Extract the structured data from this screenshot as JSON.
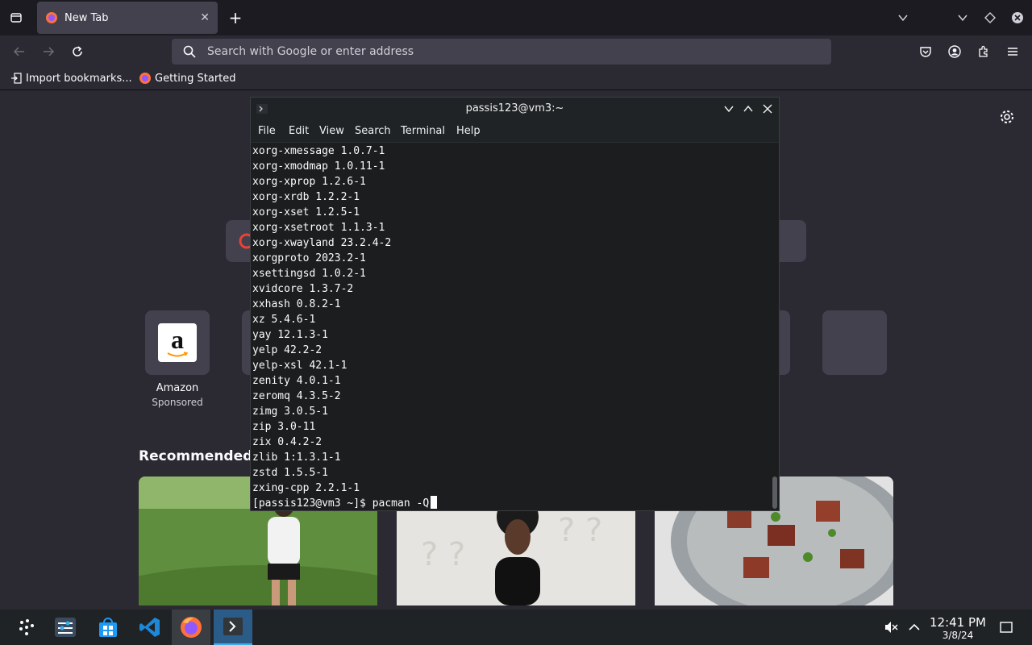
{
  "browser": {
    "tab": {
      "title": "New Tab"
    },
    "urlbar": {
      "placeholder": "Search with Google or enter address"
    },
    "bookmarks": [
      {
        "label": "Import bookmarks..."
      },
      {
        "label": "Getting Started"
      }
    ]
  },
  "newtab": {
    "shortcuts": [
      {
        "label": "Amazon",
        "sub": "Sponsored"
      }
    ],
    "recommended_heading": "Recommended b"
  },
  "terminal": {
    "title": "passis123@vm3:~",
    "menu": [
      "File",
      "Edit",
      "View",
      "Search",
      "Terminal",
      "Help"
    ],
    "lines": [
      "xorg-xmessage 1.0.7-1",
      "xorg-xmodmap 1.0.11-1",
      "xorg-xprop 1.2.6-1",
      "xorg-xrdb 1.2.2-1",
      "xorg-xset 1.2.5-1",
      "xorg-xsetroot 1.1.3-1",
      "xorg-xwayland 23.2.4-2",
      "xorgproto 2023.2-1",
      "xsettingsd 1.0.2-1",
      "xvidcore 1.3.7-2",
      "xxhash 0.8.2-1",
      "xz 5.4.6-1",
      "yay 12.1.3-1",
      "yelp 42.2-2",
      "yelp-xsl 42.1-1",
      "zenity 4.0.1-1",
      "zeromq 4.3.5-2",
      "zimg 3.0.5-1",
      "zip 3.0-11",
      "zix 0.4.2-2",
      "zlib 1:1.3.1-1",
      "zstd 1.5.5-1",
      "zxing-cpp 2.2.1-1"
    ],
    "prompt": "[passis123@vm3 ~]$ pacman -Q"
  },
  "taskbar": {
    "time": "12:41 PM",
    "date": "3/8/24"
  },
  "colors": {
    "accent": "#3daee9",
    "firefox_bg": "#2b2a33",
    "terminal_bg": "#1b1d1f"
  }
}
